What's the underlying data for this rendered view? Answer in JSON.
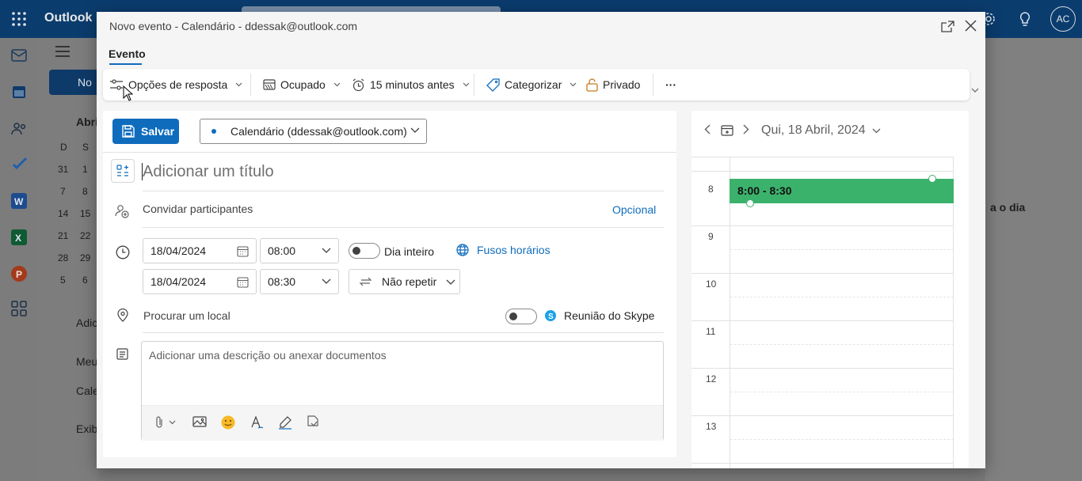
{
  "app": {
    "brand": "Outlook",
    "avatar_initials": "AC",
    "left_pane": {
      "new_button": "No",
      "month": "Abri",
      "weekday_headers": [
        "D",
        "S"
      ],
      "mini_dates": [
        [
          "31",
          "1"
        ],
        [
          "7",
          "8"
        ],
        [
          "14",
          "15"
        ],
        [
          "21",
          "22"
        ],
        [
          "28",
          "29"
        ],
        [
          "5",
          "6"
        ]
      ],
      "add_calendar": "Adic",
      "my_calendars": "Meu",
      "calendar_item": "Cale",
      "show_more": "Exib"
    },
    "right_pane_text": "a o dia"
  },
  "dialog": {
    "title": "Novo evento - Calendário - ddessak@outlook.com",
    "tab_label": "Evento",
    "ribbon": {
      "response_options": "Opções de resposta",
      "busy": "Ocupado",
      "reminder": "15 minutos antes",
      "categorize": "Categorizar",
      "private": "Privado",
      "more": "···"
    },
    "form": {
      "save_label": "Salvar",
      "calendar": "Calendário (ddessak@outlook.com)",
      "title_placeholder": "Adicionar um título",
      "invite_placeholder": "Convidar participantes",
      "optional_link": "Opcional",
      "start_date": "18/04/2024",
      "start_time": "08:00",
      "end_date": "18/04/2024",
      "end_time": "08:30",
      "all_day_label": "Dia inteiro",
      "time_zones_link": "Fusos horários",
      "repeat_label": "Não repetir",
      "location_placeholder": "Procurar um local",
      "skype_label": "Reunião do Skype",
      "description_placeholder": "Adicionar uma descrição ou anexar documentos"
    },
    "day_view": {
      "date_label": "Qui, 18 Abril, 2024",
      "hours": [
        "8",
        "9",
        "10",
        "11",
        "12",
        "13"
      ],
      "event_label": "8:00 - 8:30"
    }
  },
  "colors": {
    "accent": "#0f6cbd",
    "event_green": "#3bb26b",
    "topbar": "#0b3c6e"
  }
}
